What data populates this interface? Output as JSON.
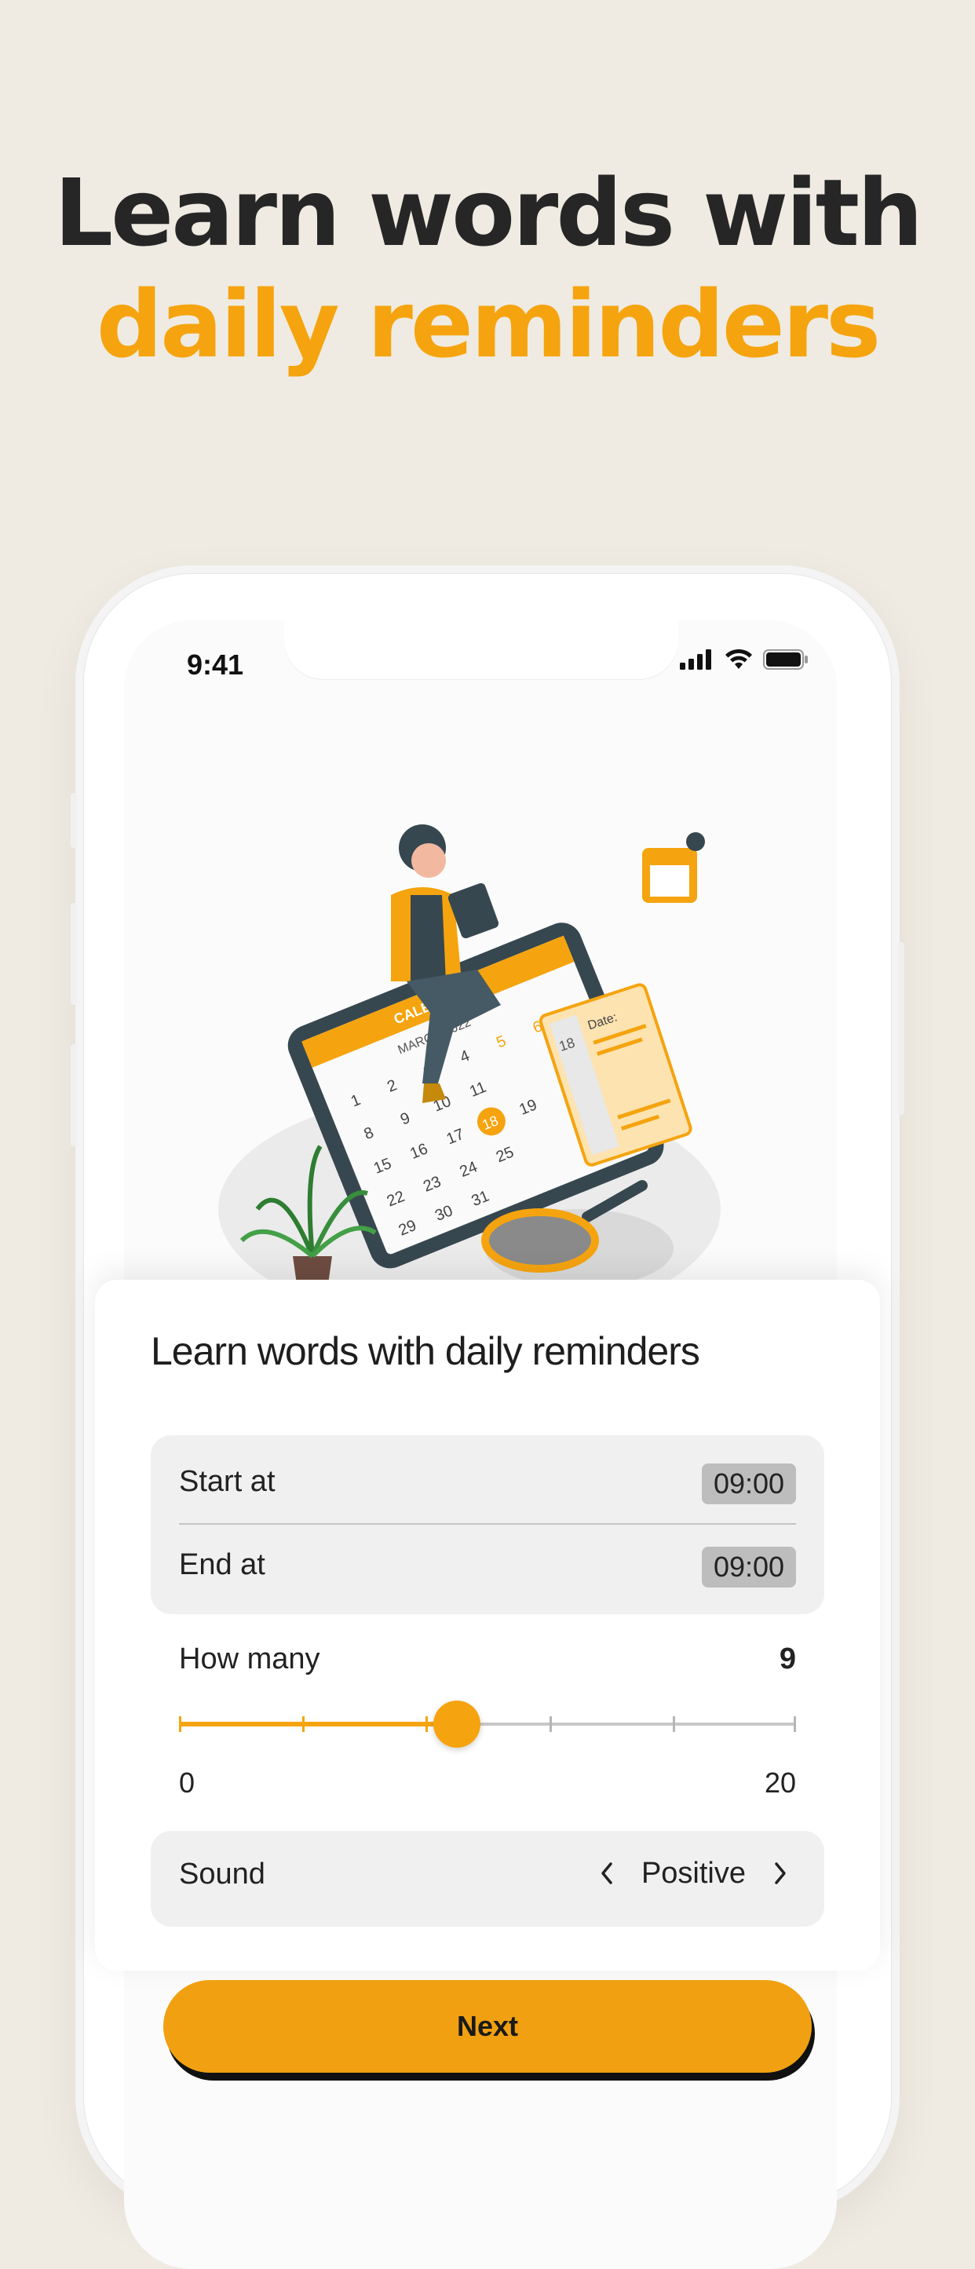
{
  "headline": {
    "line1": "Learn words with",
    "line2": "daily reminders"
  },
  "status_bar": {
    "time": "9:41",
    "icons": [
      "cellular-signal-icon",
      "wifi-icon",
      "battery-icon"
    ]
  },
  "illustration": {
    "subject": "woman-sitting-on-calendar-tablet-illustration",
    "calendar_header": "CALENDAR",
    "calendar_month": "MARCH 2022",
    "highlighted_day": "18",
    "note_label": "Date:"
  },
  "sheet": {
    "title": "Learn words with daily reminders",
    "schedule": {
      "start_label": "Start at",
      "start_value": "09:00",
      "end_label": "End at",
      "end_value": "09:00"
    },
    "how_many": {
      "label": "How many",
      "value": "9",
      "min": "0",
      "max": "20",
      "fill_fraction": 0.45
    },
    "sound": {
      "label": "Sound",
      "value": "Positive"
    }
  },
  "next_button": {
    "label": "Next"
  },
  "colors": {
    "accent": "#f5a40f",
    "background": "#efebe2",
    "headline_dark": "#262626"
  }
}
